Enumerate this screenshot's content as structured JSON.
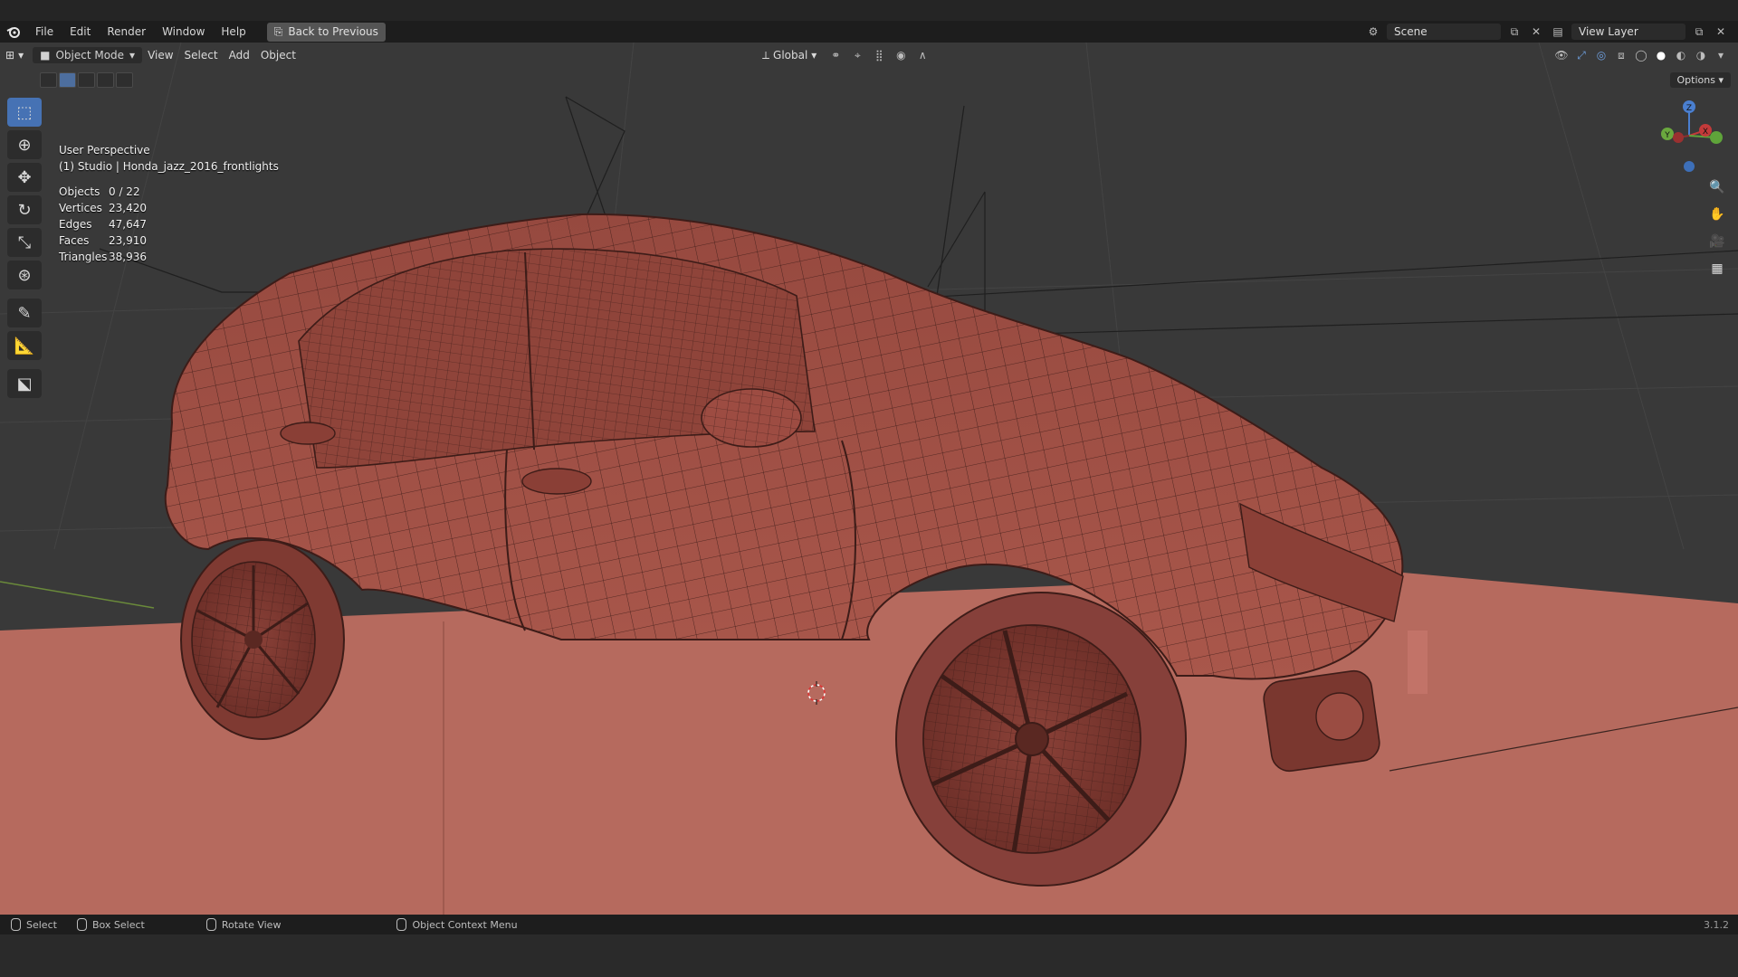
{
  "menubar": {
    "items": [
      "File",
      "Edit",
      "Render",
      "Window",
      "Help"
    ],
    "back_button": "Back to Previous",
    "scene_name": "Scene",
    "view_layer": "View Layer"
  },
  "header3d": {
    "mode": "Object Mode",
    "menus": [
      "View",
      "Select",
      "Add",
      "Object"
    ],
    "orientation": "Global",
    "options": "Options"
  },
  "viewport": {
    "perspective": "User Perspective",
    "object_name": "(1) Studio | Honda_jazz_2016_frontlights",
    "stats": [
      {
        "label": "Objects",
        "value": "0 / 22"
      },
      {
        "label": "Vertices",
        "value": "23,420"
      },
      {
        "label": "Edges",
        "value": "47,647"
      },
      {
        "label": "Faces",
        "value": "23,910"
      },
      {
        "label": "Triangles",
        "value": "38,936"
      }
    ],
    "gizmo": {
      "x": "X",
      "y": "Y",
      "z": "Z"
    }
  },
  "toolbar": {
    "tools": [
      "select-box",
      "cursor",
      "move",
      "rotate",
      "scale",
      "transform",
      "annotate",
      "measure",
      "add-cube"
    ]
  },
  "statusbar": {
    "select": "Select",
    "box_select": "Box Select",
    "rotate_view": "Rotate View",
    "context_menu": "Object Context Menu",
    "version": "3.1.2"
  },
  "colors": {
    "accent": "#4672b4",
    "model": "#9a4d45",
    "floor": "#b66a5e"
  }
}
